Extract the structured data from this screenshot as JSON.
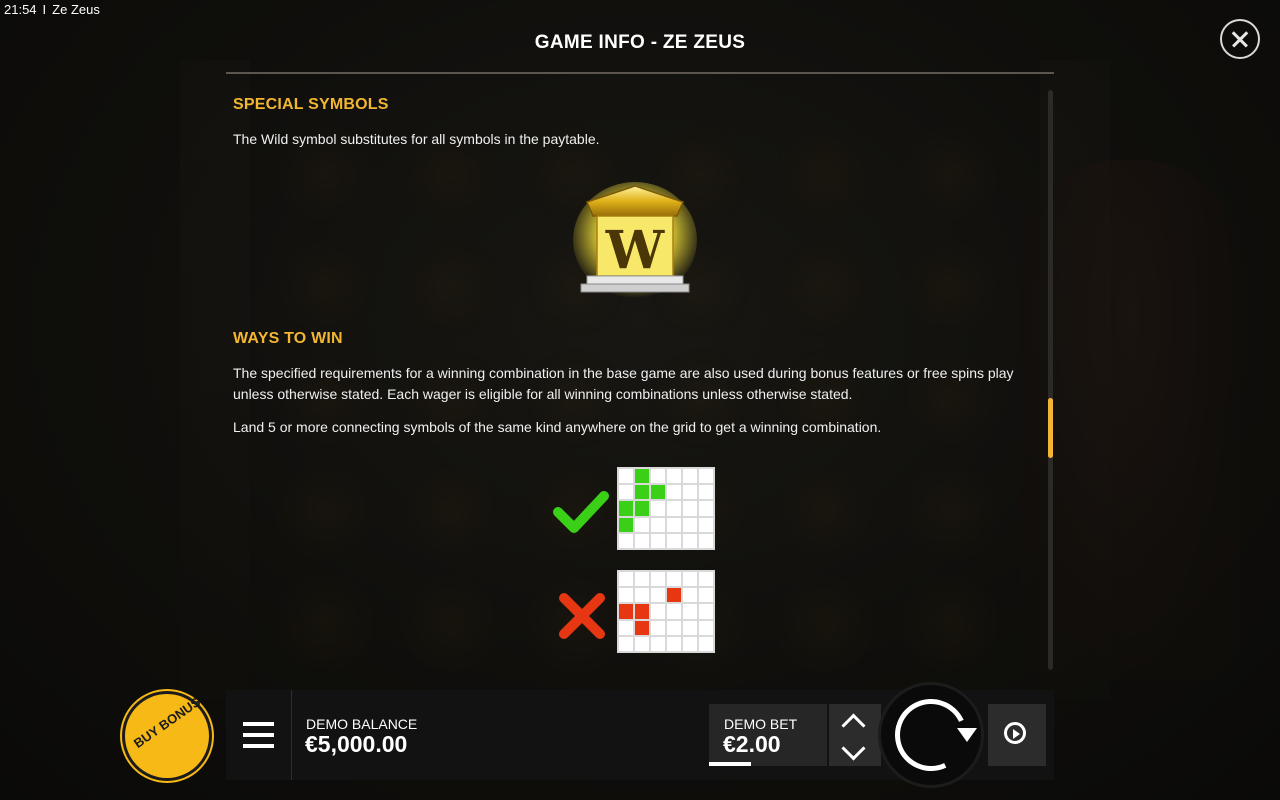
{
  "statusbar": {
    "time": "21:54",
    "separator": "I",
    "app": "Ze Zeus"
  },
  "header": {
    "title": "GAME INFO - ZE ZEUS"
  },
  "sections": {
    "special_symbols": {
      "title": "SPECIAL SYMBOLS",
      "text": "The Wild symbol substitutes for all symbols in the paytable.",
      "symbol_letter": "W"
    },
    "ways_to_win": {
      "title": "WAYS TO WIN",
      "para1": "The specified requirements for a winning combination in the base game are also used during bonus features or free spins play unless otherwise stated. Each wager is eligible for all winning combinations unless otherwise stated.",
      "para2": "Land 5 or more connecting symbols of the same kind anywhere on the grid to get a winning combination."
    }
  },
  "examples": {
    "valid_icon": "checkmark-icon",
    "invalid_icon": "cross-icon",
    "valid_cells": [
      [
        0,
        1
      ],
      [
        1,
        1
      ],
      [
        1,
        2
      ],
      [
        2,
        0
      ],
      [
        2,
        1
      ],
      [
        3,
        0
      ]
    ],
    "invalid_cells": [
      [
        1,
        3
      ],
      [
        2,
        0
      ],
      [
        2,
        1
      ],
      [
        3,
        1
      ]
    ],
    "colors": {
      "valid": "#3ad018",
      "invalid": "#e63612",
      "empty": "#ffffff"
    }
  },
  "bottom": {
    "balance_label": "DEMO BALANCE",
    "balance_value": "€5,000.00",
    "bet_label": "DEMO BET",
    "bet_value": "€2.00",
    "buy_bonus": "BUY BONUS"
  },
  "colors": {
    "accent": "#f2b632",
    "buy_bonus": "#f7b915"
  }
}
